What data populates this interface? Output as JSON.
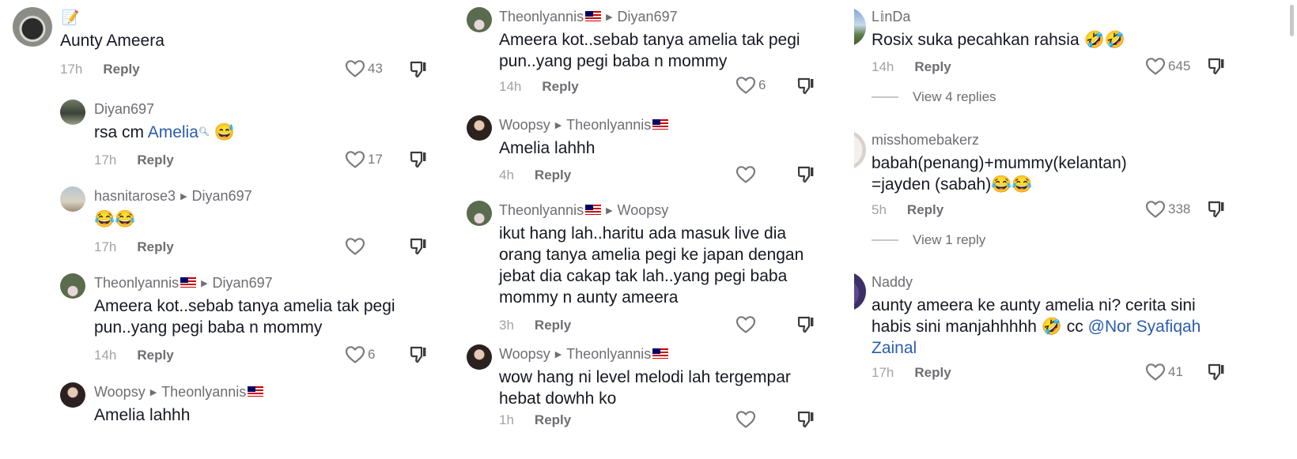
{
  "reply_label": "Reply",
  "col1": [
    {
      "author": "📝",
      "text": "Aunty Ameera",
      "time": "17h",
      "likes": "43"
    },
    {
      "author": "Diyan697",
      "text_prefix": "rsa cm ",
      "link": "Amelia",
      "emoji": "😅",
      "time": "17h",
      "likes": "17"
    },
    {
      "author": "hasnitarose3",
      "reply_to": "Diyan697",
      "emoji": "😂😂",
      "time": "17h",
      "likes": ""
    },
    {
      "author": "Theonlyannis",
      "reply_to": "Diyan697",
      "text": "Ameera kot..sebab tanya amelia tak pegi pun..yang pegi baba n mommy",
      "time": "14h",
      "likes": "6"
    },
    {
      "author": "Woopsy",
      "reply_to": "Theonlyannis",
      "text": "Amelia lahhh"
    }
  ],
  "col2": [
    {
      "author": "Theonlyannis",
      "reply_to": "Diyan697",
      "text": "Ameera kot..sebab tanya amelia tak pegi pun..yang pegi baba n mommy",
      "time": "14h",
      "likes": "6"
    },
    {
      "author": "Woopsy",
      "reply_to": "Theonlyannis",
      "text": "Amelia lahhh",
      "time": "4h",
      "likes": ""
    },
    {
      "author": "Theonlyannis",
      "reply_to": "Woopsy",
      "text": "ikut hang lah..haritu ada masuk live dia orang tanya amelia pegi ke japan dengan jebat dia cakap tak lah..yang pegi baba mommy n aunty ameera",
      "time": "3h",
      "likes": ""
    },
    {
      "author": "Woopsy",
      "reply_to": "Theonlyannis",
      "text": "wow hang ni level melodi lah tergempar hebat dowhh ko",
      "time": "1h",
      "likes": ""
    }
  ],
  "col3": [
    {
      "author": "L𝕚nDa",
      "text": "Rosix suka pecahkan rahsia 🤣🤣",
      "time": "14h",
      "likes": "645",
      "view_replies": "View 4 replies"
    },
    {
      "author": "misshomebakerz",
      "text": "babah(penang)+mummy(kelantan) =jayden (sabah)😂😂",
      "time": "5h",
      "likes": "338",
      "view_replies": "View 1 reply"
    },
    {
      "author": "Naddy",
      "text_prefix": "aunty ameera ke aunty amelia ni? cerita sini habis sini manjahhhhh 🤣 cc ",
      "link": "@Nor Syafiqah Zainal",
      "time": "17h",
      "likes": "41"
    }
  ]
}
